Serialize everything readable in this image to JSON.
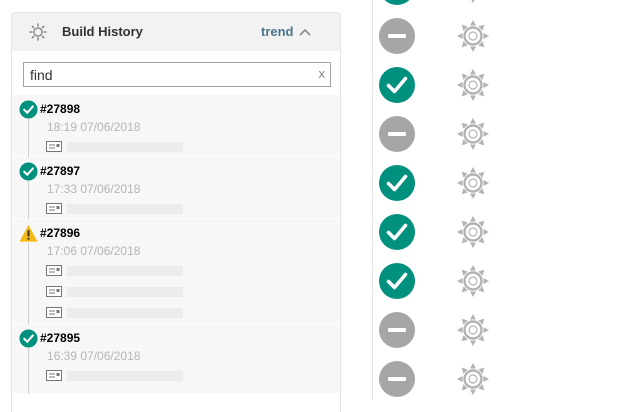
{
  "header": {
    "title": "Build History",
    "trend_label": "trend"
  },
  "search": {
    "placeholder": "find",
    "clear_label": "x"
  },
  "builds": [
    {
      "number": "#27898",
      "time": "18:19 07/06/2018",
      "status": "success",
      "changesets": 1
    },
    {
      "number": "#27897",
      "time": "17:33 07/06/2018",
      "status": "success",
      "changesets": 1
    },
    {
      "number": "#27896",
      "time": "17:06 07/06/2018",
      "status": "unstable",
      "changesets": 3
    },
    {
      "number": "#27895",
      "time": "16:39 07/06/2018",
      "status": "success",
      "changesets": 1
    }
  ],
  "right_column": {
    "statuses": [
      "success",
      "aborted",
      "success",
      "aborted",
      "success",
      "success",
      "success",
      "aborted",
      "aborted"
    ],
    "weather_icon": "weather-sunny-icon"
  },
  "colors": {
    "success": "#00907e",
    "unstable": "#f3b815",
    "aborted": "#a6a6a6",
    "trend": "#4b758b",
    "weather": "#b3b3b3"
  }
}
